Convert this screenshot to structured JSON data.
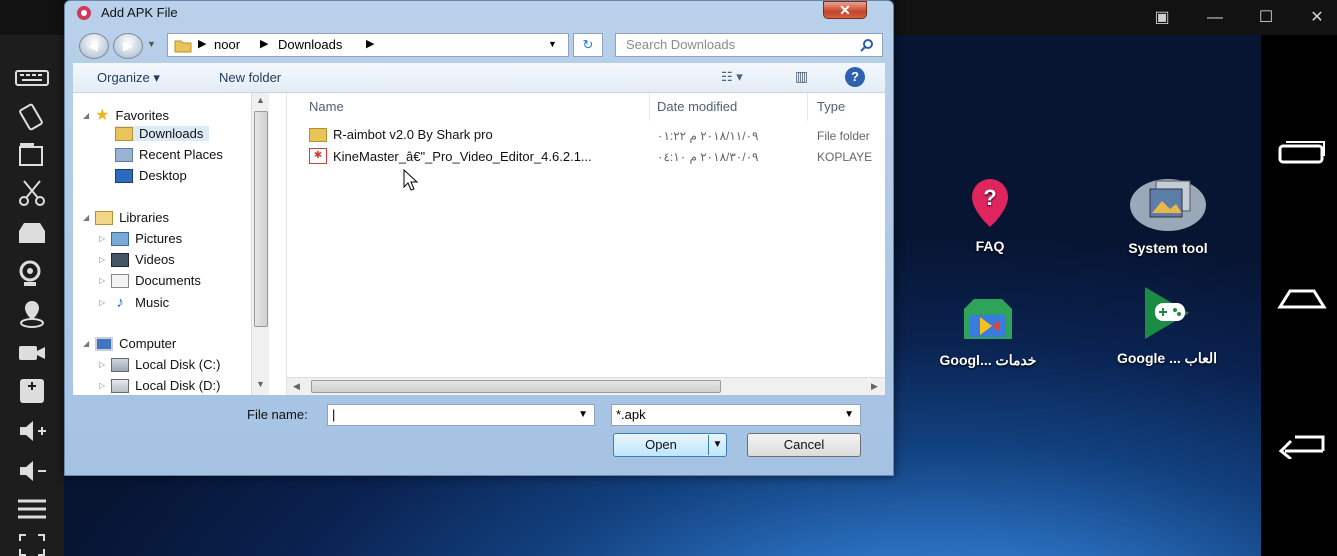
{
  "dialog": {
    "title": "Add APK File",
    "close_label": "✕",
    "breadcrumb": [
      "noor",
      "Downloads"
    ],
    "search_placeholder": "Search Downloads",
    "toolbar": {
      "organize": "Organize ▾",
      "new_folder": "New folder"
    },
    "nav": {
      "favorites": "Favorites",
      "downloads": "Downloads",
      "recent_places": "Recent Places",
      "desktop": "Desktop",
      "libraries": "Libraries",
      "pictures": "Pictures",
      "videos": "Videos",
      "documents": "Documents",
      "music": "Music",
      "computer": "Computer",
      "local_c": "Local Disk (C:)",
      "local_d": "Local Disk (D:)"
    },
    "columns": {
      "name": "Name",
      "date": "Date modified",
      "type": "Type"
    },
    "files": [
      {
        "name": "R-aimbot v2.0 By Shark pro",
        "date": "٢٠١٨/١١/٠٩ م ٠١:٢٢",
        "type": "File folder"
      },
      {
        "name": "KineMaster_â€\"_Pro_Video_Editor_4.6.2.1...",
        "date": "٢٠١٨/٣٠/٠٩ م ٠٤:١٠",
        "type": "KOPLAYE"
      }
    ],
    "file_name_label": "File name:",
    "file_name_value": "",
    "filter": "*.apk",
    "open": "Open",
    "cancel": "Cancel"
  },
  "desktop": {
    "apps": [
      {
        "label": "FAQ",
        "icon": "question-pin-icon"
      },
      {
        "label": "System tool",
        "icon": "gallery-stack-icon"
      },
      {
        "label": "Googl... خدمات",
        "icon": "google-play-services-icon"
      },
      {
        "label": "Google ... العاب",
        "icon": "google-play-games-icon"
      }
    ]
  },
  "colors": {
    "dialog_frame": "#b9d1ea",
    "close": "#c7442a",
    "accent": "#1b6ec2"
  }
}
